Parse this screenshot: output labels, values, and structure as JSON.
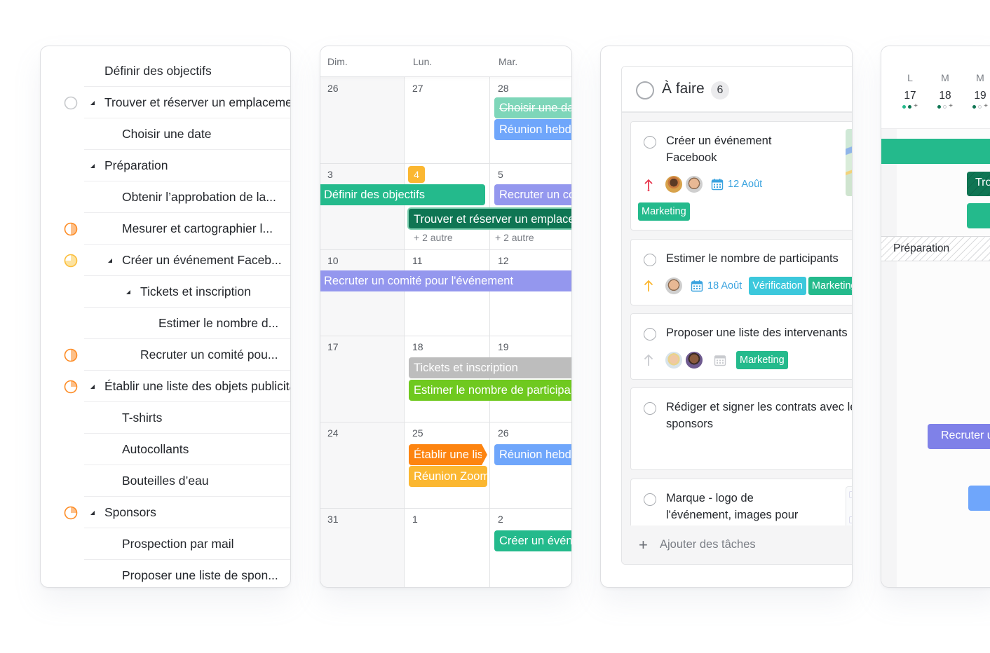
{
  "list_view": {
    "rows": [
      {
        "label": "Définir des objectifs",
        "indent": 0,
        "caret": false,
        "progress": null
      },
      {
        "label": "Trouver et réserver un emplacement",
        "indent": 0,
        "caret": true,
        "progress": "empty"
      },
      {
        "label": "Choisir une date",
        "indent": 1,
        "caret": false,
        "progress": null
      },
      {
        "label": "Préparation",
        "indent": 0,
        "caret": true,
        "progress": null
      },
      {
        "label": "Obtenir l’approbation de la...",
        "indent": 1,
        "caret": false,
        "progress": null
      },
      {
        "label": "Mesurer et cartographier l...",
        "indent": 1,
        "caret": false,
        "progress": "half-orange"
      },
      {
        "label": "Créer un événement Faceb...",
        "indent": 1,
        "caret": true,
        "progress": "three-quarter-yellow"
      },
      {
        "label": "Tickets et inscription",
        "indent": 2,
        "caret": true,
        "progress": null
      },
      {
        "label": "Estimer le nombre d...",
        "indent": 3,
        "caret": false,
        "progress": null
      },
      {
        "label": "Recruter un comité pou...",
        "indent": 2,
        "caret": false,
        "progress": "half-orange"
      },
      {
        "label": "Établir une liste des objets publicitaires",
        "indent": 0,
        "caret": true,
        "progress": "quarter-orange"
      },
      {
        "label": "T-shirts",
        "indent": 1,
        "caret": false,
        "progress": null
      },
      {
        "label": "Autocollants",
        "indent": 1,
        "caret": false,
        "progress": null
      },
      {
        "label": "Bouteilles d’eau",
        "indent": 1,
        "caret": false,
        "progress": null
      },
      {
        "label": "Sponsors",
        "indent": 0,
        "caret": true,
        "progress": "quarter-orange"
      },
      {
        "label": "Prospection par mail",
        "indent": 1,
        "caret": false,
        "progress": null
      },
      {
        "label": "Proposer une liste de spon...",
        "indent": 1,
        "caret": false,
        "progress": null
      }
    ]
  },
  "calendar_view": {
    "weekdays": [
      "Dim.",
      "Lun.",
      "Mar."
    ],
    "weeks": [
      {
        "days": [
          "26",
          "27",
          "28"
        ]
      },
      {
        "days": [
          "3",
          "4",
          "5"
        ],
        "today_index": 1
      },
      {
        "days": [
          "10",
          "11",
          "12"
        ]
      },
      {
        "days": [
          "17",
          "18",
          "19"
        ]
      },
      {
        "days": [
          "24",
          "25",
          "26"
        ]
      },
      {
        "days": [
          "31",
          "1",
          "2"
        ]
      }
    ],
    "events": [
      {
        "label": "Choisir une date",
        "color": "#7ed6b9",
        "done": true
      },
      {
        "label": "Réunion hebdomadaire",
        "color": "#6fa6fb"
      },
      {
        "label": "Définir des objectifs",
        "color": "#24ba8c"
      },
      {
        "label": "Recruter un comité",
        "color": "#9497ee"
      },
      {
        "label": "Trouver et réserver un emplacement",
        "color": "#0f7553"
      },
      {
        "label": "Recruter un comité pour l'événement",
        "color": "#9497ee"
      },
      {
        "label": "Tickets et inscription",
        "color": "#bdbdbd"
      },
      {
        "label": "Estimer le nombre de participants",
        "color": "#6fc91f"
      },
      {
        "label": "Établir une liste",
        "color": "#fd8410"
      },
      {
        "label": "Réunion Zoom",
        "color": "#fbb731"
      },
      {
        "label": "Réunion hebdomadaire",
        "color": "#6fa6fb"
      },
      {
        "label": "Créer un événement",
        "color": "#24ba8c"
      }
    ],
    "more_labels": [
      "+ 2 autre",
      "+ 2 autre"
    ]
  },
  "board_view": {
    "column": {
      "title": "À faire",
      "count": "6"
    },
    "cards": [
      {
        "title_lines": [
          "Créer un événement",
          "Facebook"
        ],
        "priority": "high",
        "priority_color": "#e8384f",
        "avatars": [
          "avatar-woman-glasses",
          "avatar-man-glasses"
        ],
        "date": "12 Août",
        "tags": [
          {
            "label": "Marketing",
            "color": "#24ba8c"
          }
        ],
        "thumbnail": "map"
      },
      {
        "title_lines": [
          "Estimer le nombre de participants"
        ],
        "priority": "medium",
        "priority_color": "#fbb731",
        "avatars": [
          "avatar-man-glasses"
        ],
        "date": "18 Août",
        "tags": [
          {
            "label": "Vérification",
            "color": "#3cc8dc"
          },
          {
            "label": "Marketing",
            "color": "#24ba8c"
          }
        ]
      },
      {
        "title_lines": [
          "Proposer une liste des intervenants"
        ],
        "priority": "low",
        "priority_color": "#c9cbcf",
        "avatars": [
          "avatar-woman-blonde",
          "avatar-man-beard"
        ],
        "date": "",
        "tags": [
          {
            "label": "Marketing",
            "color": "#24ba8c"
          }
        ]
      },
      {
        "title_lines": [
          "Rédiger et signer les contrats avec les",
          "sponsors"
        ],
        "tags": []
      },
      {
        "title_lines": [
          "Marque - logo de",
          "l'événement, images pour"
        ],
        "tags": [],
        "thumbnail": "document"
      }
    ],
    "add_task_label": "Ajouter des tâches"
  },
  "gantt_view": {
    "days": [
      {
        "dow": "L",
        "num": "17",
        "dots": [
          "filled-light",
          "filled-dark",
          "plus"
        ]
      },
      {
        "dow": "M",
        "num": "18",
        "dots": [
          "filled-dark",
          "hollow",
          "plus"
        ]
      },
      {
        "dow": "M",
        "num": "19",
        "dots": [
          "filled-dark",
          "hollow",
          "plus"
        ]
      }
    ],
    "bars": [
      {
        "label": "",
        "color": "#24ba8c"
      },
      {
        "label": "Trouver et réserver un emplacement",
        "color": "#0f7553"
      },
      {
        "label": "",
        "color": "#24ba8c"
      },
      {
        "label": "Recruter un comité",
        "color": "#7f81e8"
      },
      {
        "label": "",
        "color": "#6fa6fb"
      }
    ],
    "section_label": "Préparation",
    "colors": {
      "dot_light": "#24ba8c",
      "dot_dark": "#0f7553"
    }
  }
}
